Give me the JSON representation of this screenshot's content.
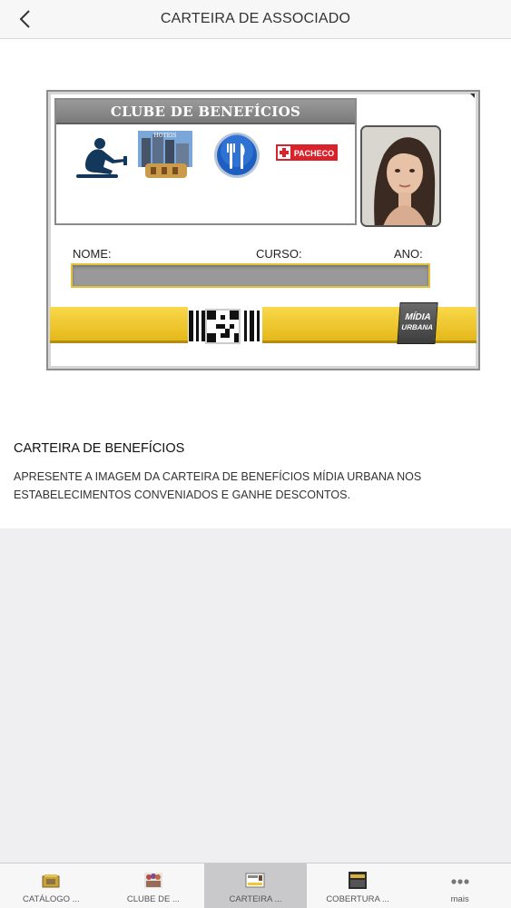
{
  "header": {
    "title": "CARTEIRA DE ASSOCIADO",
    "back_icon": "chevron-left-icon"
  },
  "card": {
    "club_title": "CLUBE DE BENEFÍCIOS",
    "hotel_logo_text": "HOTEIS",
    "pacheco_logo_text": "PACHECO",
    "fields": {
      "nome": "NOME:",
      "curso": "CURSO:",
      "ano": "ANO:"
    },
    "brand_logo": {
      "line1": "MÍDIA",
      "line2": "URBANA"
    }
  },
  "description": {
    "title": "CARTEIRA DE BENEFÍCIOS",
    "text": "APRESENTE A IMAGEM DA CARTEIRA DE BENEFÍCIOS MÍDIA URBANA NOS ESTABELECIMENTOS CONVENIADOS E GANHE DESCONTOS."
  },
  "tabbar": {
    "tabs": [
      {
        "label": "CATÁLOGO ...",
        "icon": "catalog-icon",
        "active": false
      },
      {
        "label": "CLUBE DE ...",
        "icon": "club-icon",
        "active": false
      },
      {
        "label": "CARTEIRA ...",
        "icon": "card-icon",
        "active": true
      },
      {
        "label": "COBERTURA ...",
        "icon": "coverage-icon",
        "active": false
      },
      {
        "label": "mais",
        "icon": "more-icon",
        "active": false
      }
    ]
  },
  "colors": {
    "card_yellow": "#f5cf3a",
    "header_bg": "#f7f7f8",
    "page_bg": "#efeff1",
    "active_tab": "#c9c9cc"
  }
}
